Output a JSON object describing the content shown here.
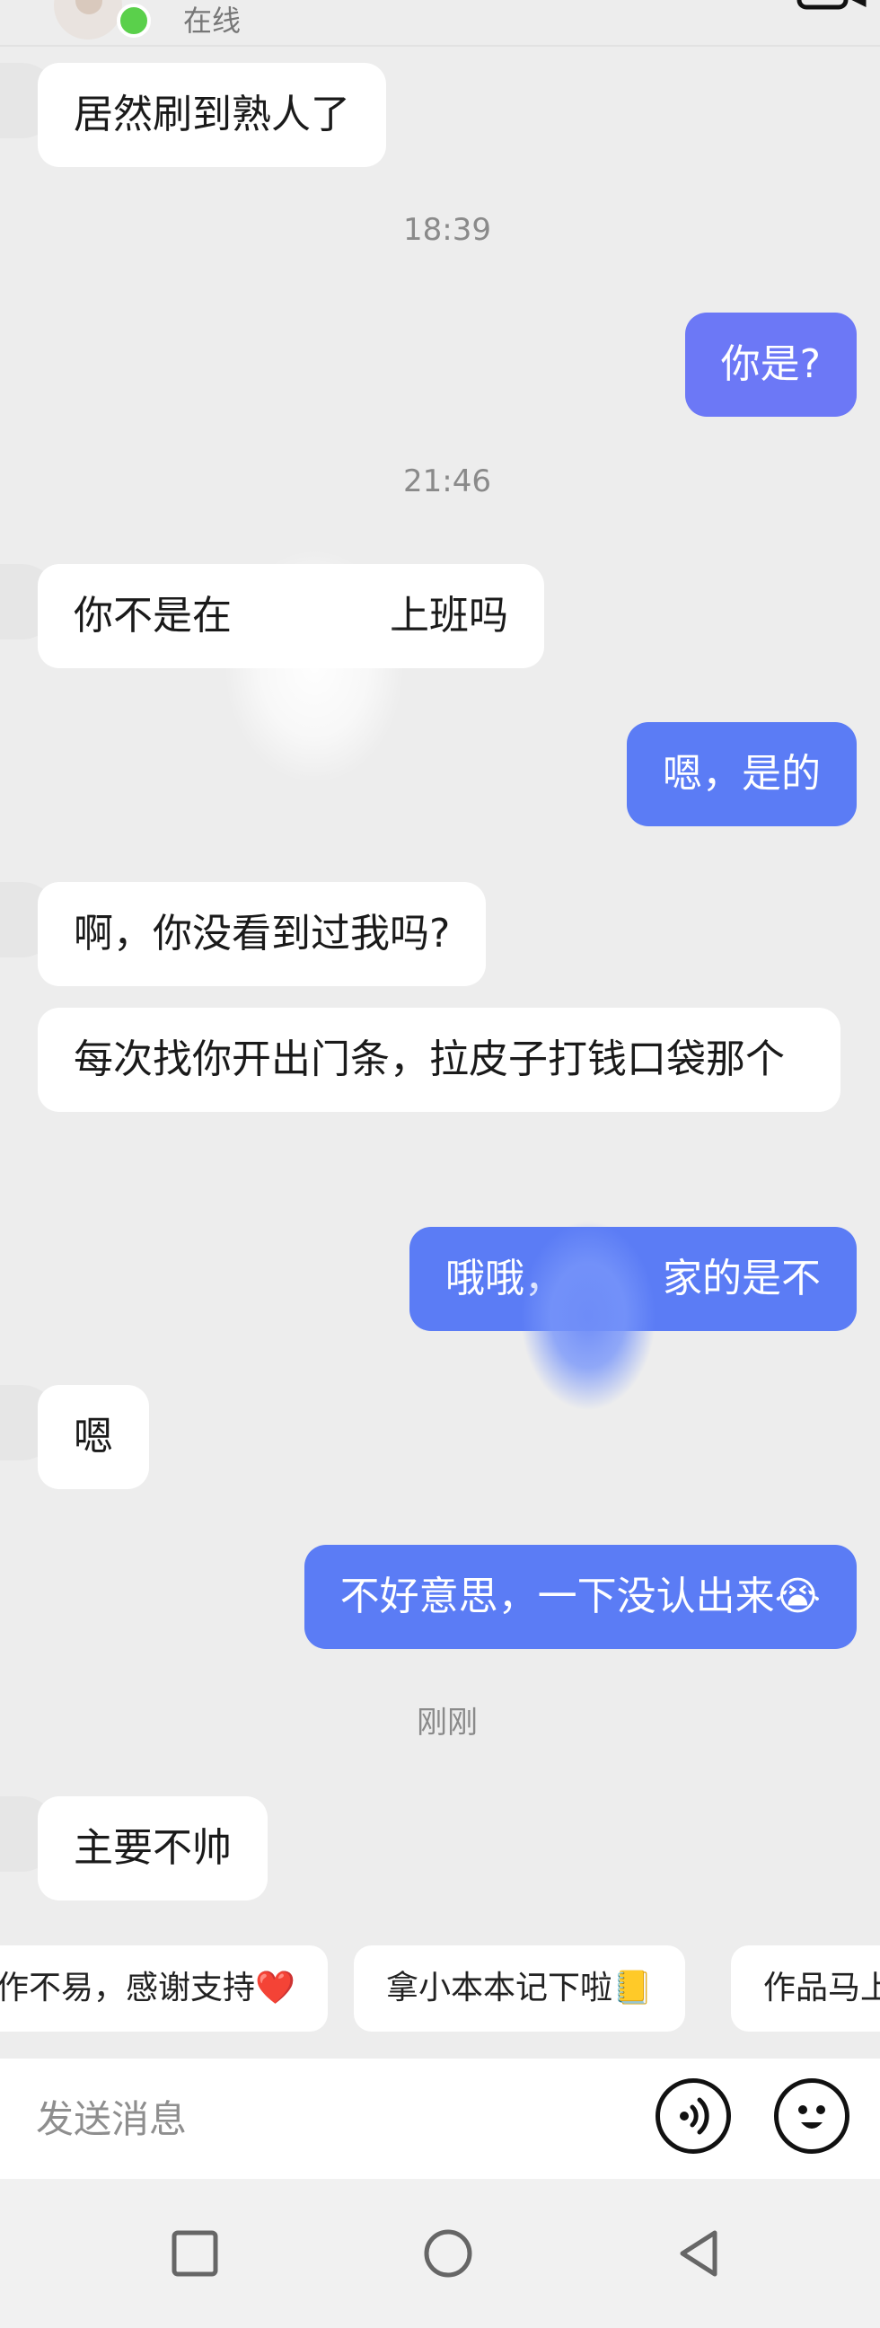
{
  "header": {
    "status": "在线"
  },
  "messages": [
    {
      "side": "in",
      "text": "居然刷到熟人了"
    },
    {
      "side": "time",
      "text": "18:39"
    },
    {
      "side": "out",
      "text": "你是?"
    },
    {
      "side": "time",
      "text": "21:46"
    },
    {
      "side": "in",
      "text": "你不是在　　　　上班吗"
    },
    {
      "side": "out",
      "text": "嗯，是的"
    },
    {
      "side": "in",
      "text": "啊，你没看到过我吗?"
    },
    {
      "side": "in",
      "text": "每次找你开出门条，拉皮子打钱口袋那个"
    },
    {
      "side": "out",
      "text": "哦哦，　　　家的是不"
    },
    {
      "side": "in",
      "text": "嗯"
    },
    {
      "side": "out",
      "text": "不好意思，一下没认出来😭"
    },
    {
      "side": "time",
      "text": "刚刚"
    },
    {
      "side": "in",
      "text": "主要不帅"
    }
  ],
  "quick_replies": [
    "作不易，感谢支持❤️",
    "拿小本本记下啦📒",
    "作品马上"
  ],
  "input": {
    "placeholder": "发送消息"
  },
  "icons": {
    "video": "video-camera-icon",
    "voice": "voice-input-icon",
    "emoji": "emoji-icon",
    "nav_recent": "square-recent-apps-icon",
    "nav_home": "circle-home-icon",
    "nav_back": "triangle-back-icon"
  },
  "colors": {
    "outgoing_bubble": "#5b7cf5",
    "incoming_bubble": "#ffffff",
    "background": "#ededed",
    "online_dot": "#5ad04b"
  }
}
